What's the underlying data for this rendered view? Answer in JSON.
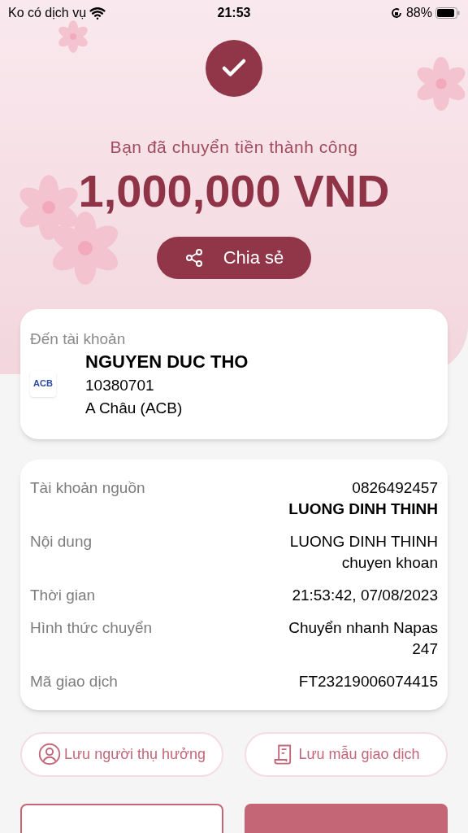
{
  "status_bar": {
    "carrier": "Ko có dịch vụ",
    "time": "21:53",
    "battery": "88%"
  },
  "result": {
    "message": "Bạn đã chuyển tiền thành công",
    "amount": "1,000,000 VND",
    "share_label": "Chia sẻ"
  },
  "recipient": {
    "heading": "Đến tài khoản",
    "bank_logo": "ACB",
    "name": "NGUYEN DUC THO",
    "account": "10380701",
    "bank": "A Châu (ACB)"
  },
  "details": [
    {
      "label": "Tài khoản nguồn",
      "lines": [
        "0826492457"
      ],
      "emphasis": "LUONG DINH THINH"
    },
    {
      "label": "Nội dung",
      "lines": [
        "LUONG DINH THINH",
        "chuyen khoan"
      ]
    },
    {
      "label": "Thời gian",
      "lines": [
        "21:53:42, 07/08/2023"
      ]
    },
    {
      "label": "Hình thức chuyển",
      "lines": [
        "Chuyển nhanh Napas",
        "247"
      ]
    },
    {
      "label": "Mã giao dịch",
      "lines": [
        "FT23219006074415"
      ]
    }
  ],
  "actions": [
    {
      "label": "Lưu người thụ hưởng",
      "kind": "person"
    },
    {
      "label": "Lưu mẫu giao dịch",
      "kind": "receipt"
    }
  ],
  "bottom_buttons": [
    {
      "kind": "outline"
    },
    {
      "kind": "filled"
    }
  ]
}
